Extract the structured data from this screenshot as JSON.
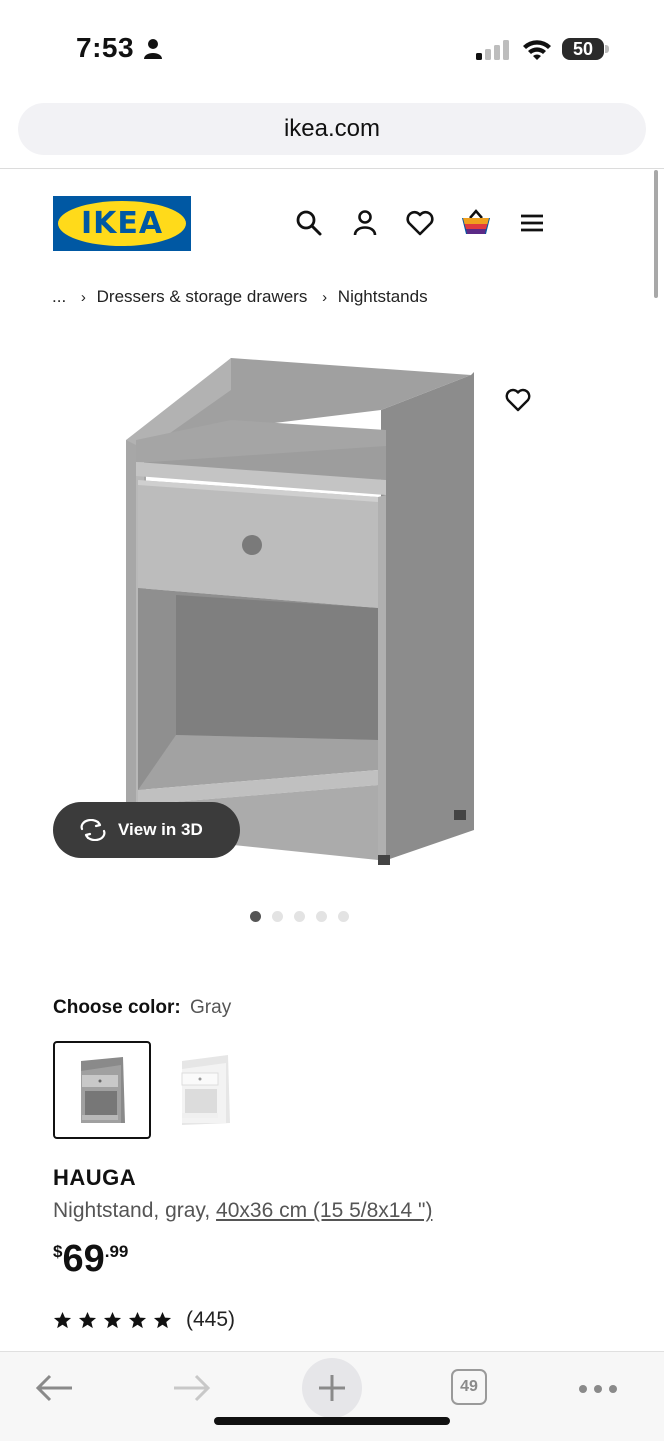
{
  "status_bar": {
    "time": "7:53",
    "battery": "50"
  },
  "browser": {
    "url": "ikea.com",
    "tab_count": "49"
  },
  "header": {
    "logo_text": "IKEA"
  },
  "breadcrumb": {
    "ellipsis": "...",
    "items": [
      "Dressers & storage drawers",
      "Nightstands"
    ]
  },
  "gallery": {
    "view_3d_label": "View in 3D",
    "image_count": 5,
    "active_index": 0
  },
  "color_choice": {
    "label": "Choose color:",
    "value": "Gray",
    "options": [
      "gray",
      "white"
    ],
    "selected": "gray"
  },
  "product": {
    "name": "HAUGA",
    "description": "Nightstand, gray,",
    "size": "40x36 cm (15 5/8x14 \")",
    "price_currency": "$",
    "price_main": "69",
    "price_cents": ".99",
    "rating": 5,
    "review_count": "(445)"
  },
  "colors": {
    "ikea_blue": "#0058a3",
    "ikea_yellow": "#ffda1a",
    "furniture_gray": "#9b9b9b"
  }
}
